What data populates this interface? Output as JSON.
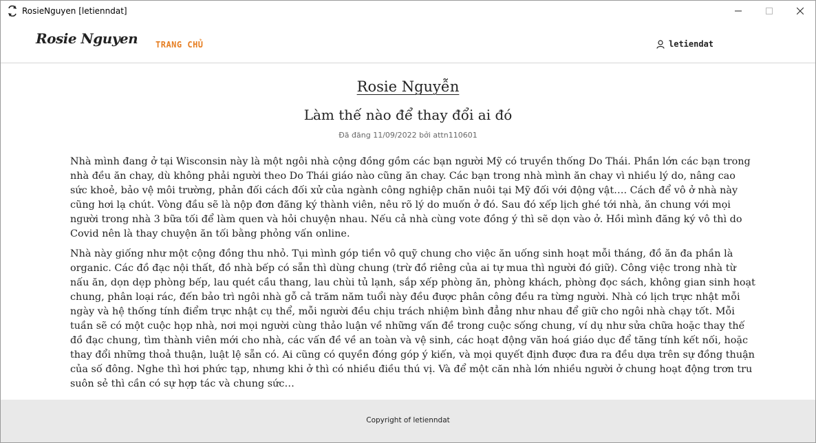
{
  "window": {
    "title": "RosieNguyen [letienndat]"
  },
  "navbar": {
    "brand": "Rosie Nguyen",
    "home_label": "TRANG CHỦ",
    "username": "letiendat"
  },
  "blog": {
    "title": "Rosie Nguyễn"
  },
  "post": {
    "title": "Làm thế nào để thay đổi ai đó",
    "meta": "Đã đăng 11/09/2022 bởi attn110601",
    "paragraphs": [
      "Nhà mình đang ở tại Wisconsin này là một ngôi nhà cộng đồng gồm các bạn người Mỹ có truyền thống Do Thái. Phần lớn các bạn trong nhà đều ăn chay, dù không phải người theo Do Thái giáo nào cũng ăn chay. Các bạn trong nhà mình ăn chay vì nhiều lý do, nâng cao sức khoẻ, bảo vệ môi trường, phản đối cách đối xử của ngành công nghiệp chăn nuôi tại Mỹ đối với động vật…. Cách để vô ở nhà này cũng hơi lạ chút. Vòng đầu sẽ là nộp đơn đăng ký thành viên, nêu rõ lý do muốn ở đó. Sau đó xếp lịch ghé tới nhà, ăn chung với mọi người trong nhà 3 bữa tối để làm quen và hỏi chuyện nhau. Nếu cả nhà cùng vote đồng ý thì sẽ dọn vào ở. Hồi mình đăng ký vô thì do Covid nên là thay chuyện ăn tối bằng phỏng vấn online.",
      "Nhà này giống như một cộng đồng thu nhỏ. Tụi mình góp tiền vô quỹ chung cho việc ăn uống sinh hoạt mỗi tháng, đồ ăn đa phần là organic. Các đồ đạc nội thất, đồ nhà bếp có sẵn thì dùng chung (trừ đồ riêng của ai tự mua thì người đó giữ). Công việc trong nhà từ nấu ăn, dọn dẹp phòng bếp, lau quét cầu thang, lau chùi tủ lạnh, sắp xếp phòng ăn, phòng khách, phòng đọc sách, không gian sinh hoạt chung, phân loại rác, đến bảo trì ngôi nhà gỗ cả trăm năm tuổi này đều được phân công đều ra từng người. Nhà có lịch trực nhật mỗi ngày và hệ thống tính điểm trực nhật cụ thể, mỗi người đều chịu trách nhiệm bình đẳng như nhau để giữ cho ngôi nhà chạy tốt. Mỗi tuần sẽ có một cuộc họp nhà, nơi mọi người cùng thảo luận về những vấn đề trong cuộc sống chung, ví dụ như sửa chữa hoặc thay thế đồ đạc chung, tìm thành viên mới cho nhà, các vấn đề về an toàn và vệ sinh, các hoạt động văn hoá giáo dục để tăng tính kết nối, hoặc thay đổi những thoả thuận, luật lệ sẵn có. Ai cũng có quyền đóng góp ý kiến, và mọi quyết định được đưa ra đều dựa trên sự đồng thuận của số đông. Nghe thì hơi phức tạp, nhưng khi ở thì có nhiều điều thú vị. Và để một căn nhà lớn nhiều người ở chung hoạt động trơn tru suôn sẻ thì cần có sự hợp tác và chung sức…"
    ]
  },
  "footer": {
    "text": "Copyright of letienndat"
  },
  "icons": {
    "app": "app-icon",
    "user": "user-icon",
    "minimize": "minimize-icon",
    "maximize": "maximize-icon",
    "close": "close-icon"
  },
  "colors": {
    "accent": "#e67e22",
    "footer_bg": "#e9e9e9",
    "text": "#222222"
  }
}
